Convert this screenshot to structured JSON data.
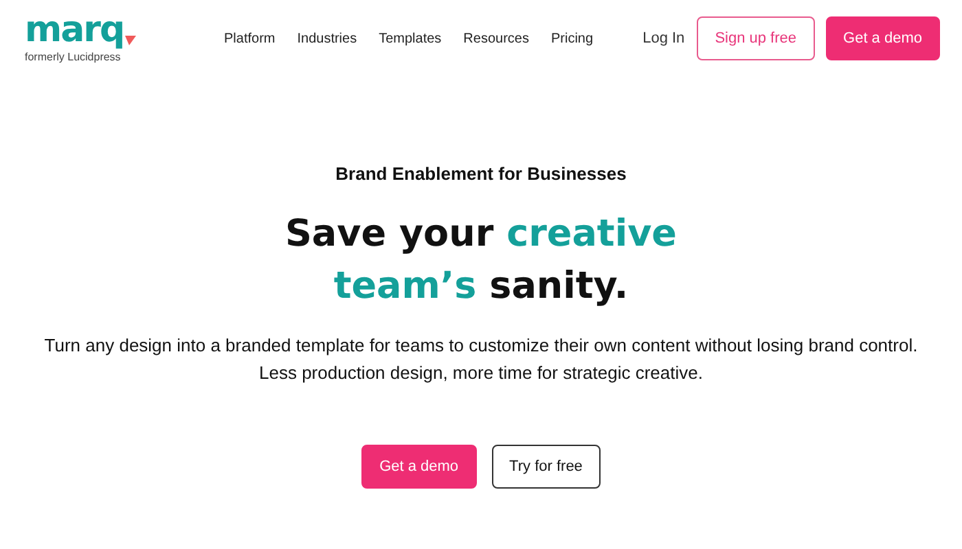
{
  "header": {
    "logo": "marq",
    "logo_subtitle": "formerly Lucidpress",
    "nav": [
      "Platform",
      "Industries",
      "Templates",
      "Resources",
      "Pricing"
    ],
    "login": "Log In",
    "signup": "Sign up free",
    "demo": "Get a demo"
  },
  "hero": {
    "eyebrow": "Brand Enablement for Businesses",
    "headline": [
      {
        "text": "Save your ",
        "accent": false
      },
      {
        "text": "creative",
        "accent": true
      },
      {
        "text": "team’s",
        "accent": true
      },
      {
        "text": " sanity.",
        "accent": false
      }
    ],
    "description": "Turn any design into a branded template for teams to customize their own content without losing brand control. Less production design, more time for strategic creative.",
    "primary_button": "Get a demo",
    "secondary_button": "Try for free"
  }
}
